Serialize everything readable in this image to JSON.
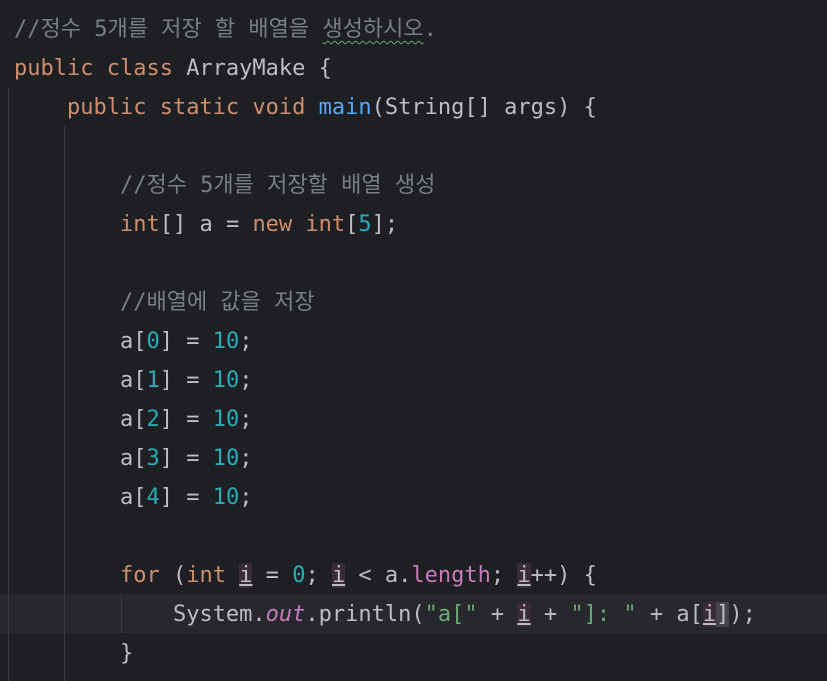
{
  "editor": {
    "lines": [
      {
        "name": "code-line-1",
        "tokens": [
          {
            "name": "comment-token",
            "cls": "cmt",
            "text": "//정수 5개를 저장 할 배열을 "
          },
          {
            "name": "comment-token-warning",
            "cls": "cmt squiggle",
            "text": "생성하시오"
          },
          {
            "name": "comment-token",
            "cls": "cmt",
            "text": "."
          }
        ]
      },
      {
        "name": "code-line-2",
        "tokens": [
          {
            "name": "keyword-token",
            "cls": "kw",
            "text": "public class "
          },
          {
            "name": "class-name-token",
            "cls": "",
            "text": "ArrayMake {"
          }
        ]
      },
      {
        "name": "code-line-3",
        "tokens": [
          {
            "name": "indent-token",
            "cls": "",
            "text": "    "
          },
          {
            "name": "keyword-token",
            "cls": "kw",
            "text": "public static void "
          },
          {
            "name": "method-name-token",
            "cls": "fn",
            "text": "main"
          },
          {
            "name": "code-token",
            "cls": "",
            "text": "(String[] args) {"
          }
        ]
      },
      {
        "name": "code-line-4",
        "tokens": []
      },
      {
        "name": "code-line-5",
        "tokens": [
          {
            "name": "indent-token",
            "cls": "",
            "text": "        "
          },
          {
            "name": "comment-token",
            "cls": "cmt",
            "text": "//정수 5개를 저장할 배열 생성"
          }
        ]
      },
      {
        "name": "code-line-6",
        "tokens": [
          {
            "name": "indent-token",
            "cls": "",
            "text": "        "
          },
          {
            "name": "keyword-token",
            "cls": "kw",
            "text": "int"
          },
          {
            "name": "code-token",
            "cls": "",
            "text": "[] a = "
          },
          {
            "name": "keyword-token",
            "cls": "kw",
            "text": "new int"
          },
          {
            "name": "code-token",
            "cls": "",
            "text": "["
          },
          {
            "name": "number-token",
            "cls": "num",
            "text": "5"
          },
          {
            "name": "code-token",
            "cls": "",
            "text": "];"
          }
        ]
      },
      {
        "name": "code-line-7",
        "tokens": []
      },
      {
        "name": "code-line-8",
        "tokens": [
          {
            "name": "indent-token",
            "cls": "",
            "text": "        "
          },
          {
            "name": "comment-token",
            "cls": "cmt",
            "text": "//배열에 값을 저장"
          }
        ]
      },
      {
        "name": "code-line-9",
        "tokens": [
          {
            "name": "indent-token",
            "cls": "",
            "text": "        "
          },
          {
            "name": "code-token",
            "cls": "",
            "text": "a["
          },
          {
            "name": "number-token",
            "cls": "num",
            "text": "0"
          },
          {
            "name": "code-token",
            "cls": "",
            "text": "] = "
          },
          {
            "name": "number-token",
            "cls": "num",
            "text": "10"
          },
          {
            "name": "code-token",
            "cls": "",
            "text": ";"
          }
        ]
      },
      {
        "name": "code-line-10",
        "tokens": [
          {
            "name": "indent-token",
            "cls": "",
            "text": "        "
          },
          {
            "name": "code-token",
            "cls": "",
            "text": "a["
          },
          {
            "name": "number-token",
            "cls": "num",
            "text": "1"
          },
          {
            "name": "code-token",
            "cls": "",
            "text": "] = "
          },
          {
            "name": "number-token",
            "cls": "num",
            "text": "10"
          },
          {
            "name": "code-token",
            "cls": "",
            "text": ";"
          }
        ]
      },
      {
        "name": "code-line-11",
        "tokens": [
          {
            "name": "indent-token",
            "cls": "",
            "text": "        "
          },
          {
            "name": "code-token",
            "cls": "",
            "text": "a["
          },
          {
            "name": "number-token",
            "cls": "num",
            "text": "2"
          },
          {
            "name": "code-token",
            "cls": "",
            "text": "] = "
          },
          {
            "name": "number-token",
            "cls": "num",
            "text": "10"
          },
          {
            "name": "code-token",
            "cls": "",
            "text": ";"
          }
        ]
      },
      {
        "name": "code-line-12",
        "tokens": [
          {
            "name": "indent-token",
            "cls": "",
            "text": "        "
          },
          {
            "name": "code-token",
            "cls": "",
            "text": "a["
          },
          {
            "name": "number-token",
            "cls": "num",
            "text": "3"
          },
          {
            "name": "code-token",
            "cls": "",
            "text": "] = "
          },
          {
            "name": "number-token",
            "cls": "num",
            "text": "10"
          },
          {
            "name": "code-token",
            "cls": "",
            "text": ";"
          }
        ]
      },
      {
        "name": "code-line-13",
        "tokens": [
          {
            "name": "indent-token",
            "cls": "",
            "text": "        "
          },
          {
            "name": "code-token",
            "cls": "",
            "text": "a["
          },
          {
            "name": "number-token",
            "cls": "num",
            "text": "4"
          },
          {
            "name": "code-token",
            "cls": "",
            "text": "] = "
          },
          {
            "name": "number-token",
            "cls": "num",
            "text": "10"
          },
          {
            "name": "code-token",
            "cls": "",
            "text": ";"
          }
        ]
      },
      {
        "name": "code-line-14",
        "tokens": []
      },
      {
        "name": "code-line-15",
        "tokens": [
          {
            "name": "indent-token",
            "cls": "",
            "text": "        "
          },
          {
            "name": "keyword-token",
            "cls": "kw",
            "text": "for "
          },
          {
            "name": "code-token",
            "cls": "",
            "text": "("
          },
          {
            "name": "keyword-token",
            "cls": "kw",
            "text": "int "
          },
          {
            "name": "variable-token-highlighted",
            "cls": "hl-var",
            "text": "i"
          },
          {
            "name": "code-token",
            "cls": "",
            "text": " = "
          },
          {
            "name": "number-token",
            "cls": "num",
            "text": "0"
          },
          {
            "name": "code-token",
            "cls": "",
            "text": "; "
          },
          {
            "name": "variable-token-highlighted",
            "cls": "hl-var",
            "text": "i"
          },
          {
            "name": "code-token",
            "cls": "",
            "text": " < a."
          },
          {
            "name": "field-token",
            "cls": "fld",
            "text": "length"
          },
          {
            "name": "code-token",
            "cls": "",
            "text": "; "
          },
          {
            "name": "variable-token-highlighted",
            "cls": "hl-var",
            "text": "i"
          },
          {
            "name": "code-token",
            "cls": "",
            "text": "++) {"
          }
        ]
      },
      {
        "name": "code-line-16",
        "tokens": [
          {
            "name": "indent-token",
            "cls": "",
            "text": "            "
          },
          {
            "name": "code-token",
            "cls": "",
            "text": "System."
          },
          {
            "name": "static-field-token",
            "cls": "stat",
            "text": "out"
          },
          {
            "name": "code-token",
            "cls": "",
            "text": ".println("
          },
          {
            "name": "string-token",
            "cls": "str",
            "text": "\"a[\""
          },
          {
            "name": "code-token",
            "cls": "",
            "text": " + "
          },
          {
            "name": "variable-token-highlighted",
            "cls": "hl-var",
            "text": "i"
          },
          {
            "name": "code-token",
            "cls": "",
            "text": " + "
          },
          {
            "name": "string-token",
            "cls": "str",
            "text": "\"]: \""
          },
          {
            "name": "code-token",
            "cls": "",
            "text": " + a["
          },
          {
            "name": "variable-token-highlighted",
            "cls": "hl-var",
            "text": "i"
          },
          {
            "name": "bracket-token-matched",
            "cls": "bracket-match",
            "text": "]"
          },
          {
            "name": "code-token",
            "cls": "",
            "text": ");"
          }
        ]
      },
      {
        "name": "code-line-17",
        "tokens": [
          {
            "name": "indent-token",
            "cls": "",
            "text": "        "
          },
          {
            "name": "code-token",
            "cls": "",
            "text": "}"
          }
        ]
      }
    ]
  }
}
